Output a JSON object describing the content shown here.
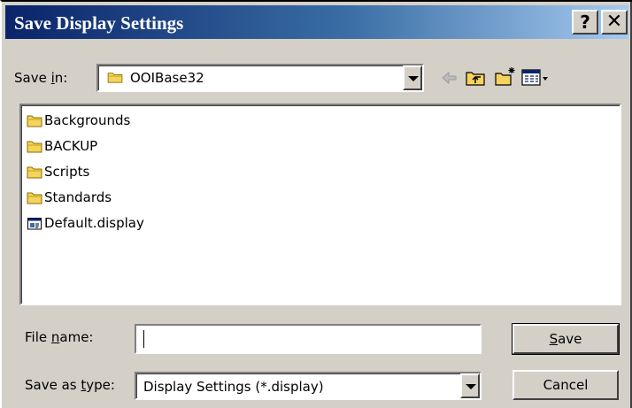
{
  "window": {
    "title": "Save Display Settings",
    "help_glyph": "?",
    "close_glyph": "✕"
  },
  "save_in": {
    "label_prefix": "Save ",
    "label_accel": "i",
    "label_suffix": "n:",
    "value": "OOIBase32",
    "icon": "folder-icon"
  },
  "toolbar": {
    "icons": [
      "back-arrow-icon",
      "up-folder-icon",
      "new-folder-icon",
      "view-menu-icon"
    ]
  },
  "files": [
    {
      "name": "Backgrounds",
      "icon": "folder-icon"
    },
    {
      "name": "BACKUP",
      "icon": "folder-icon"
    },
    {
      "name": "Scripts",
      "icon": "folder-icon"
    },
    {
      "name": "Standards",
      "icon": "folder-icon"
    },
    {
      "name": "Default.display",
      "icon": "display-file-icon"
    }
  ],
  "file_name": {
    "label_prefix": "File ",
    "label_accel": "n",
    "label_suffix": "ame:",
    "value": ""
  },
  "save_as_type": {
    "label_prefix": "Save as ",
    "label_accel": "t",
    "label_suffix": "ype:",
    "value": "Display Settings (*.display)"
  },
  "buttons": {
    "save_accel": "S",
    "save_rest": "ave",
    "cancel": "Cancel"
  },
  "colors": {
    "face": "#d4d0c8",
    "title_start": "#0a246a",
    "title_end": "#a6caf0",
    "folder": "#f4d35e"
  }
}
